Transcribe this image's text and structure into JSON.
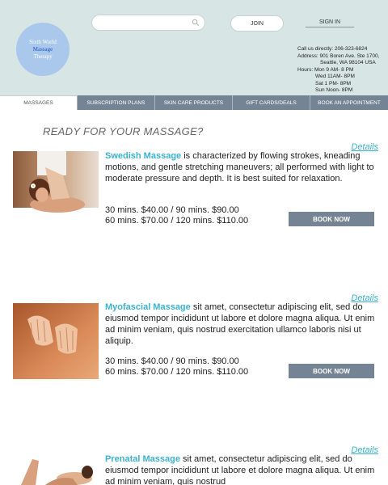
{
  "header": {
    "logo": {
      "line1": "Sixth World",
      "line2": "Massage",
      "line3": "Therapy"
    },
    "search": {
      "placeholder": ""
    },
    "join_label": "JOIN",
    "signin_label": "SIGN IN",
    "contact": {
      "phone_line": "Call us directly: 206-323-6824",
      "address_line1": "Address: 901 Boren Ave. Ste 1700,",
      "address_line2": "Seattle, WA 98104 USA",
      "hours_line1": "Hours: Mon 9 AM- 8 PM",
      "hours_line2": "Wed 11AM- 8PM",
      "hours_line3": "Sat   1 PM- 8PM",
      "hours_line4": "Sun   Noon- 8PM"
    }
  },
  "nav": {
    "tabs": [
      {
        "label": "MASSAGES",
        "active": true
      },
      {
        "label": "SUBSCRIPTION PLANS",
        "active": false
      },
      {
        "label": "SKIN CARE PRODUCTS",
        "active": false
      },
      {
        "label": "GIFT CARDS/DEALS",
        "active": false
      },
      {
        "label": "BOOK AN APPOINTMENT",
        "active": false
      }
    ]
  },
  "main": {
    "title": "READY FOR YOUR MASSAGE?",
    "services": [
      {
        "name": "Swedish Massage",
        "description": "  is characterized by flowing strokes, kneading motions, and gentle stretching maneuvers; all performed with light to moderate pressure and depth. It is best suited for relaxation.",
        "price_line1": "30 mins. $40.00  /  90 mins. $90.00",
        "price_line2": "60 mins. $70.00  /  120 mins. $110.00",
        "details_label": "Details",
        "book_label": "BOOK NOW"
      },
      {
        "name": "Myofascial Massage",
        "description": " sit amet, consectetur adipiscing elit, sed do eiusmod tempor incididunt ut labore et dolore magna aliqua. Ut enim ad minim veniam, quis nostrud exercitation ullamco laboris nisi ut aliquip.",
        "price_line1": "30 mins. $40.00  /  90 mins. $90.00",
        "price_line2": "60 mins. $70.00  /  120 mins. $110.00",
        "details_label": "Details",
        "book_label": "BOOK NOW"
      },
      {
        "name": "Prenatal Massage",
        "description": " sit amet, consectetur adipiscing elit, sed do eiusmod tempor incididunt ut labore et dolore magna aliqua. Ut enim ad minim veniam, quis nostrud",
        "details_label": "Details"
      }
    ]
  },
  "colors": {
    "header_bg": "#d7e5e4",
    "nav_bg": "#758494",
    "accent": "#3bb2d0",
    "logo_circle": "#a9c8ec",
    "logo_text_accent": "#1e52c8"
  }
}
